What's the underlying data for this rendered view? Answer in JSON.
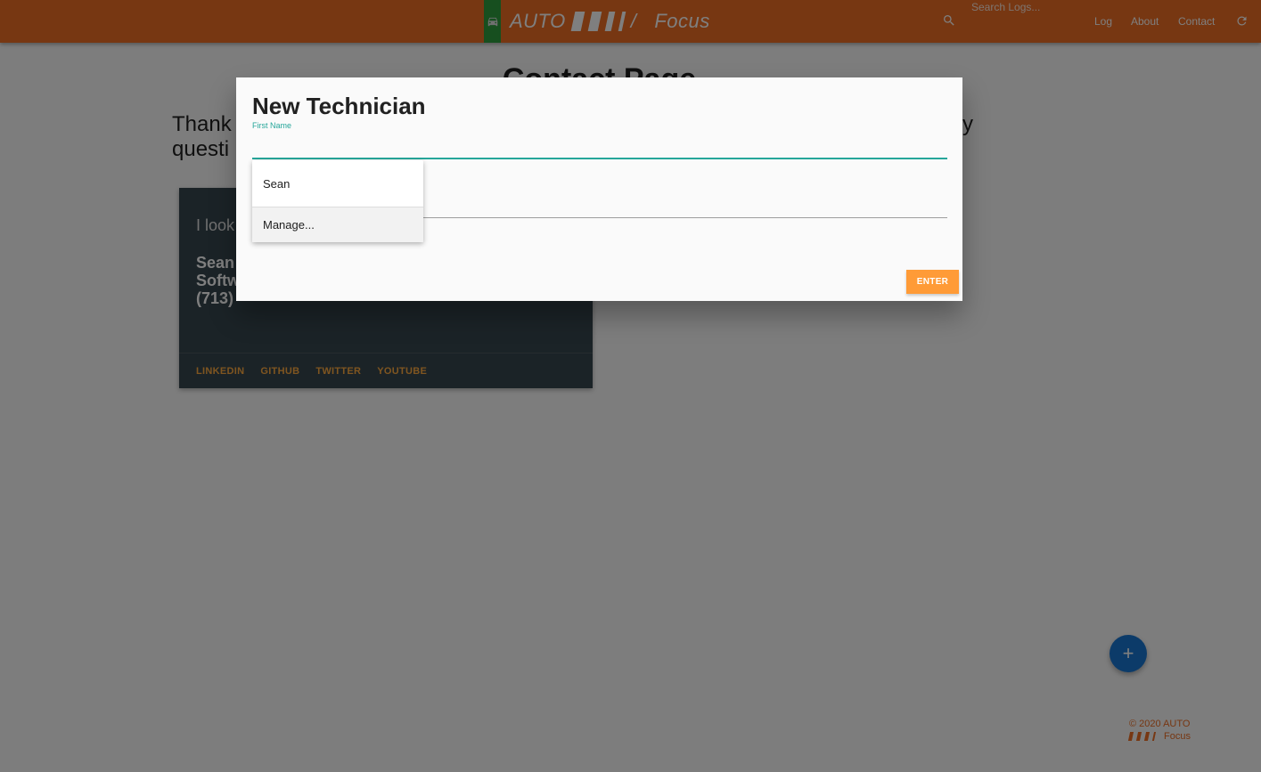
{
  "navbar": {
    "brand_auto": "AUTO",
    "brand_slash": "/",
    "brand_focus": "Focus",
    "search_placeholder": "Search Logs...",
    "links": [
      {
        "label": "Log"
      },
      {
        "label": "About"
      },
      {
        "label": "Contact"
      }
    ],
    "colors": {
      "bar": "#ee6e24",
      "car_box": "#2e9e3e"
    },
    "icons": [
      "car-icon",
      "search-icon",
      "refresh-icon"
    ]
  },
  "page": {
    "title": "Contact Page",
    "thanks_start": "Thank",
    "thanks_line2_start": "questi",
    "thanks_end": "y"
  },
  "card": {
    "quote": "I look",
    "name": "Sean",
    "role": "Softw",
    "phone": "(713)",
    "links": [
      "LINKEDIN",
      "GITHUB",
      "TWITTER",
      "YOUTUBE"
    ]
  },
  "fab": {
    "label": "+"
  },
  "footer": {
    "copyright": "© 2020 AUTO",
    "focus": "Focus"
  },
  "modal": {
    "title": "New Technician",
    "first_name_label": "First Name",
    "first_name_value": "",
    "enter_label": "ENTER",
    "dropdown": [
      "Sean",
      "Manage..."
    ]
  }
}
